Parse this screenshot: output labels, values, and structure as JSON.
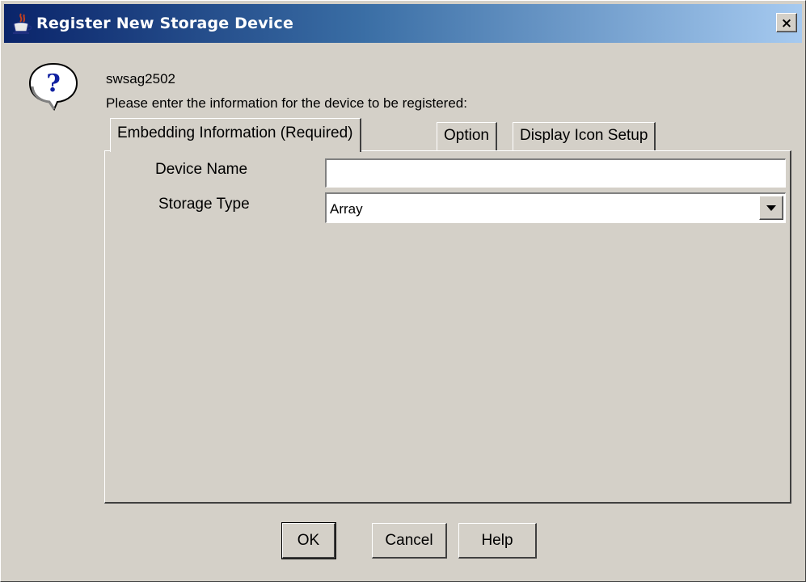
{
  "window": {
    "title": "Register New Storage Device",
    "close_symbol": "×"
  },
  "dialog": {
    "icon": "question-icon",
    "device_id": "swsag2502",
    "prompt": "Please enter the information for the device to be registered:"
  },
  "tabs": [
    {
      "label": "Embedding Information (Required)",
      "active": true
    },
    {
      "label": "Option",
      "active": false
    },
    {
      "label": "Display Icon Setup",
      "active": false
    }
  ],
  "form": {
    "device_name": {
      "label": "Device Name",
      "value": ""
    },
    "storage_type": {
      "label": "Storage Type",
      "value": "Array"
    }
  },
  "buttons": {
    "ok": "OK",
    "cancel": "Cancel",
    "help": "Help"
  },
  "colors": {
    "titlebar_start": "#0a246a",
    "titlebar_end": "#a6caf0",
    "face": "#d4d0c8"
  }
}
